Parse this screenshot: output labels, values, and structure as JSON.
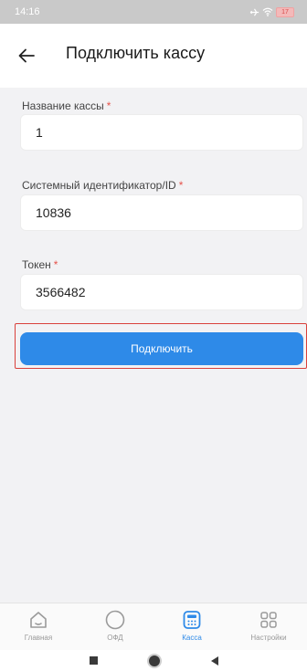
{
  "status_bar": {
    "time": "14:16",
    "battery": "17"
  },
  "header": {
    "title": "Подключить кассу"
  },
  "form": {
    "fields": [
      {
        "label": "Название кассы",
        "required_mark": "*",
        "value": "1"
      },
      {
        "label": "Системный идентификатор/ID",
        "required_mark": "*",
        "value": "10836"
      },
      {
        "label": "Токен",
        "required_mark": "*",
        "value": "3566482"
      }
    ],
    "submit_label": "Подключить"
  },
  "tabbar": {
    "items": [
      {
        "label": "Главная",
        "icon": "home-icon",
        "active": false
      },
      {
        "label": "ОФД",
        "icon": "circle-icon",
        "active": false
      },
      {
        "label": "Касса",
        "icon": "cash-register-icon",
        "active": true
      },
      {
        "label": "Настройки",
        "icon": "grid-icon",
        "active": false
      }
    ]
  },
  "colors": {
    "accent": "#2e8ae8",
    "required": "#e5534b",
    "highlight": "#d9403b"
  }
}
